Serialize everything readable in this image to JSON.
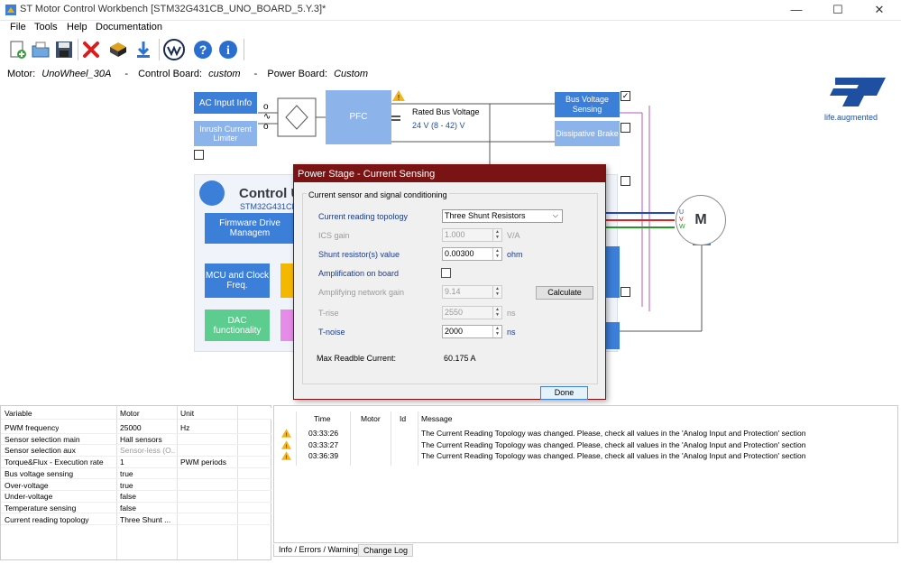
{
  "window": {
    "title": "ST Motor Control Workbench [STM32G431CB_UNO_BOARD_5.Y.3]*",
    "minimize": "—",
    "maximize": "☐",
    "close": "✕"
  },
  "menu": {
    "items": [
      "File",
      "Tools",
      "Help",
      "Documentation"
    ]
  },
  "info": {
    "motor_label": "Motor:",
    "motor_value": "UnoWheel_30A",
    "sep": "-",
    "control_label": "Control Board:",
    "control_value": "custom",
    "power_label": "Power Board:",
    "power_value": "Custom"
  },
  "logo": {
    "tagline": "life.augmented"
  },
  "diagram": {
    "ac_input": "AC Input Info",
    "inrush": "Inrush Current Limiter",
    "pfc": "PFC",
    "rated_bus_label": "Rated Bus Voltage",
    "rated_bus_value": "24 V (8 - 42) V",
    "bus_voltage_sensing": "Bus Voltage Sensing",
    "dissipative_brake": "Dissipative Brake",
    "control_unit": "Control U",
    "mcu_name": "STM32G431CB",
    "firmware": "Firmware Drive Managem",
    "mcu_clock": "MCU and Clock Freq.",
    "dac": "DAC functionality",
    "motor_letter": "M",
    "phase_u": "U",
    "phase_v": "V",
    "phase_w": "W"
  },
  "dialog": {
    "title": "Power Stage - Current Sensing",
    "group_label": "Current sensor and signal conditioning",
    "topology_label": "Current reading topology",
    "topology_value": "Three Shunt Resistors",
    "ics_gain_label": "ICS gain",
    "ics_gain_value": "1.000",
    "ics_gain_unit": "V/A",
    "shunt_label": "Shunt resistor(s) value",
    "shunt_value": "0.00300",
    "shunt_unit": "ohm",
    "amp_label": "Amplification on board",
    "amp_gain_label": "Amplifying network gain",
    "amp_gain_value": "9.14",
    "calculate": "Calculate",
    "trise_label": "T-rise",
    "trise_value": "2550",
    "trise_unit": "ns",
    "tnoise_label": "T-noise",
    "tnoise_value": "2000",
    "tnoise_unit": "ns",
    "max_current_label": "Max Readble Current:",
    "max_current_value": "60.175 A",
    "done": "Done"
  },
  "variables": {
    "headers": [
      "Variable",
      "Motor",
      "Unit"
    ],
    "rows": [
      [
        "PWM frequency",
        "25000",
        "Hz"
      ],
      [
        "Sensor selection main",
        "Hall sensors",
        ""
      ],
      [
        "Sensor selection aux",
        "Sensor-less (O...",
        ""
      ],
      [
        "Torque&Flux - Execution rate",
        "1",
        "PWM periods"
      ],
      [
        "Bus voltage sensing",
        "true",
        ""
      ],
      [
        "Over-voltage",
        "true",
        ""
      ],
      [
        "Under-voltage",
        "false",
        ""
      ],
      [
        "Temperature sensing",
        "false",
        ""
      ],
      [
        "Current reading topology",
        "Three Shunt ...",
        ""
      ]
    ]
  },
  "messages": {
    "headers": [
      "Time",
      "Motor",
      "Id",
      "Message"
    ],
    "rows": [
      [
        "03:33:26",
        "",
        "",
        "The Current Reading Topology was changed. Please, check all values in the 'Analog Input and Protection' section"
      ],
      [
        "03:33:27",
        "",
        "",
        "The Current Reading Topology was changed. Please, check all values in the 'Analog Input and Protection' section"
      ],
      [
        "03:36:39",
        "",
        "",
        "The Current Reading Topology was changed. Please, check all values in the 'Analog Input and Protection' section"
      ]
    ]
  },
  "tabs": {
    "info": "Info / Errors / Warnings",
    "changelog": "Change Log"
  },
  "colors": {
    "accent_blue": "#3c7fd9",
    "light_blue": "#8cb3ea",
    "dialog_title": "#7a1414",
    "st_blue": "#1f4fa0"
  }
}
